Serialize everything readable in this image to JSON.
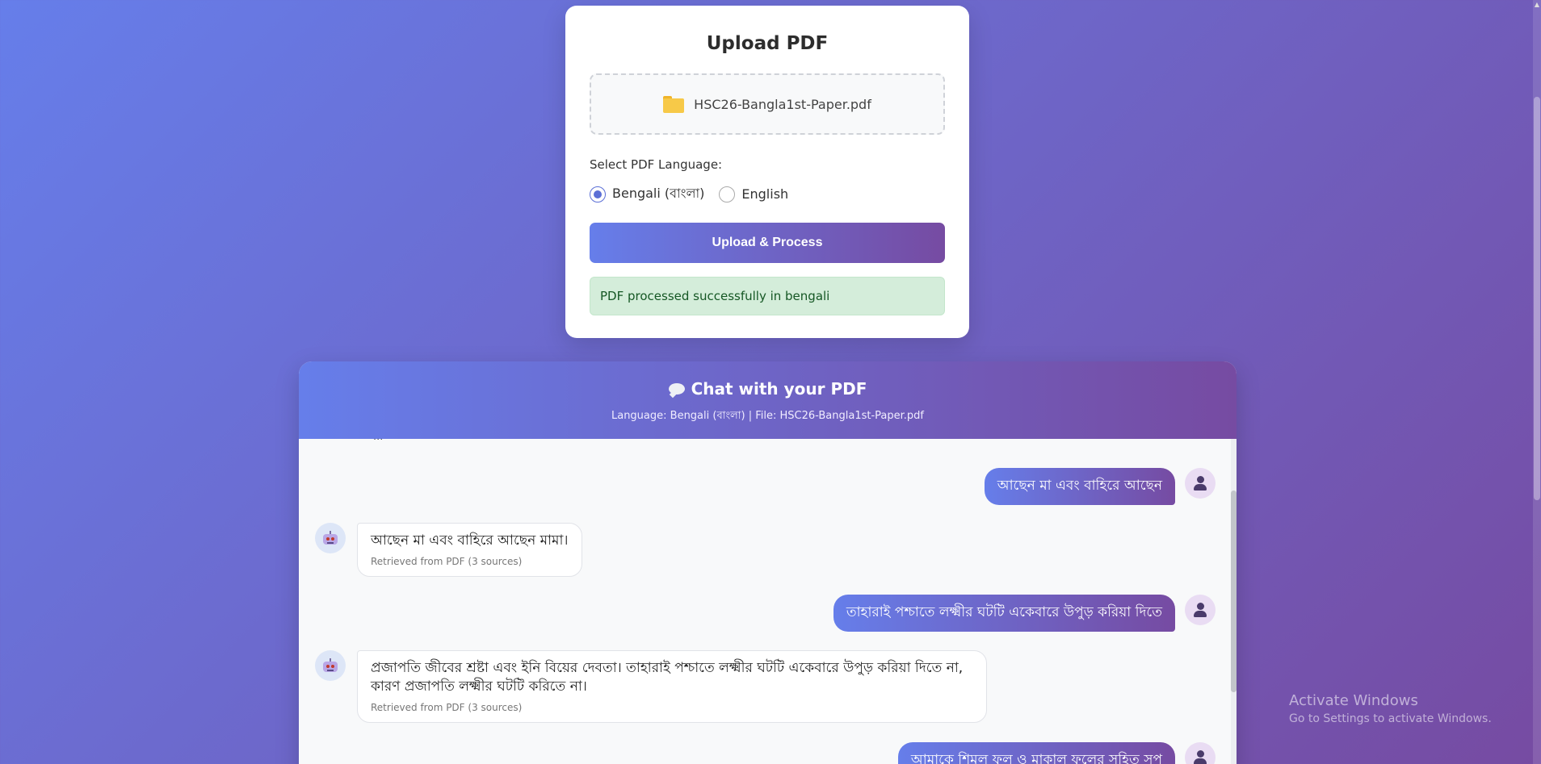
{
  "upload": {
    "title": "Upload PDF",
    "file_name": "HSC26-Bangla1st-Paper.pdf",
    "file_icon": "folder-icon",
    "language_label": "Select PDF Language:",
    "language_options": [
      {
        "label": "Bengali (বাংলা)",
        "selected": true
      },
      {
        "label": "English",
        "selected": false
      }
    ],
    "button_label": "Upload & Process",
    "status_message": "PDF processed successfully in bengali"
  },
  "chat": {
    "title": "Chat with your PDF",
    "subtitle": "Language: Bengali (বাংলা) | File: HSC26-Bangla1st-Paper.pdf",
    "clipped_text": "...",
    "messages": [
      {
        "role": "user",
        "text": "আছেন মা এবং বাহিরে আছেন"
      },
      {
        "role": "bot",
        "text": "আছেন মা এবং বাহিরে আছেন মামা।",
        "source": "Retrieved from PDF (3 sources)"
      },
      {
        "role": "user",
        "text": "তাহারাই পশ্চাতে লক্ষ্মীর ঘটটি একেবারে উপুড় করিয়া দিতে"
      },
      {
        "role": "bot",
        "text": "প্রজাপতি জীবের শ্রষ্টা এবং ইনি বিয়ের দেবতা। তাহারাই পশ্চাতে লক্ষ্মীর ঘটটি একেবারে উপুড় করিয়া দিতে না, কারণ প্রজাপতি লক্ষ্মীর ঘটটি করিতে না।",
        "source": "Retrieved from PDF (3 sources)"
      },
      {
        "role": "user",
        "text": "আমাকে শিমুল ফুল ও মাকাল ফুলের সহিত সুপ"
      }
    ]
  },
  "system": {
    "watermark_title": "Activate Windows",
    "watermark_sub": "Go to Settings to activate Windows."
  },
  "colors": {
    "gradient_start": "#667eea",
    "gradient_end": "#764ba2",
    "success_bg": "#d4edda",
    "success_text": "#155724"
  }
}
